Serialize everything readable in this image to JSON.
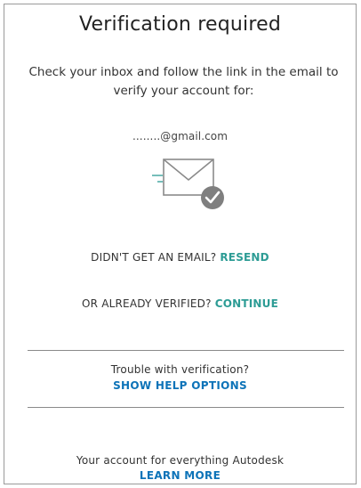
{
  "page": {
    "title": "Verification required",
    "instructions": "Check your inbox and follow the link in the email to verify your account for:",
    "email": "........@gmail.com"
  },
  "icons": {
    "envelope": "envelope-check-icon"
  },
  "resend": {
    "prompt": "DIDN'T GET AN EMAIL?",
    "link": "RESEND"
  },
  "continue": {
    "prompt": "OR ALREADY VERIFIED?",
    "link": "CONTINUE"
  },
  "help": {
    "prompt": "Trouble with verification?",
    "link": "SHOW HELP OPTIONS"
  },
  "footer": {
    "text": "Your account for everything Autodesk",
    "link": "LEARN MORE"
  },
  "colors": {
    "accent_teal": "#2d9c95",
    "link_blue": "#0d73b8",
    "icon_gray": "#8a8a8a"
  }
}
